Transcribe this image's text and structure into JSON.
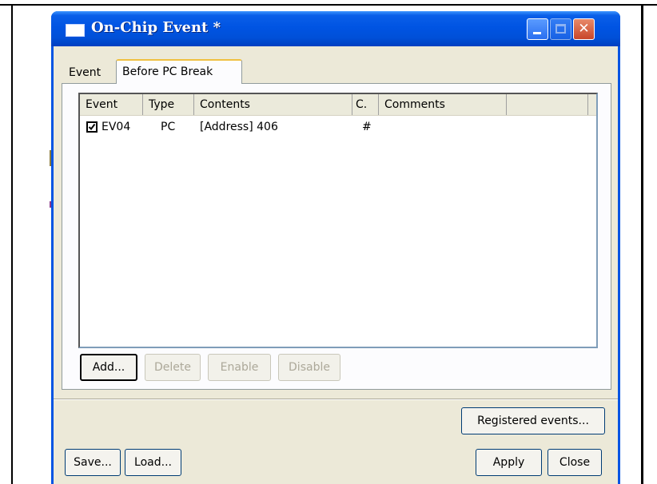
{
  "window": {
    "title": "On-Chip Event *"
  },
  "tabs": [
    {
      "label": "Event",
      "active": false
    },
    {
      "label": "Before PC Break",
      "active": true
    }
  ],
  "list": {
    "columns": [
      "Event",
      "Type",
      "Contents",
      "C.",
      "Comments",
      ""
    ],
    "rows": [
      {
        "checked": true,
        "event": "EV04",
        "type": "PC",
        "contents": "[Address] 406",
        "c": "#",
        "comments": ""
      }
    ]
  },
  "list_buttons": {
    "add": "Add...",
    "delete": "Delete",
    "enable": "Enable",
    "disable": "Disable"
  },
  "footer": {
    "registered_events": "Registered events...",
    "save": "Save...",
    "load": "Load...",
    "apply": "Apply",
    "close": "Close"
  },
  "colors": {
    "titlebar": "#0054e3",
    "window_bg": "#ece9d8",
    "disabled_text": "#aca899"
  },
  "icons": [
    "window-icon",
    "minimize-icon",
    "maximize-icon",
    "close-icon",
    "checkbox-checked-icon"
  ]
}
